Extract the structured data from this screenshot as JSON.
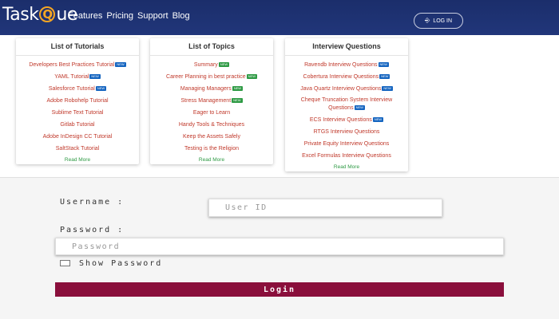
{
  "header": {
    "logo_left": "Task",
    "logo_q": "Q",
    "logo_right": "ue",
    "nav": [
      "Features",
      "Pricing",
      "Support",
      "Blog"
    ],
    "login_label": "LOG IN",
    "login_icon": "login-icon"
  },
  "panels": [
    {
      "title": "List of Tutorials",
      "items": [
        {
          "text": "Developers Best Practices Tutorial",
          "badge": "NEW"
        },
        {
          "text": "YAML Tutorial",
          "badge": "NEW"
        },
        {
          "text": "Salesforce Tutorial",
          "badge": "NEW"
        },
        {
          "text": "Adobe Robohelp Tutorial"
        },
        {
          "text": "Sublime Text Tutorial"
        },
        {
          "text": "Gitlab Tutorial"
        },
        {
          "text": "Adobe InDesign CC Tutorial"
        },
        {
          "text": "SaltStack Tutorial"
        }
      ],
      "read_more": "Read More"
    },
    {
      "title": "List of Topics",
      "items": [
        {
          "text": "Summary",
          "badge": "NEW"
        },
        {
          "text": "Career Planning in best practice",
          "badge": "NEW"
        },
        {
          "text": "Managing Managers",
          "badge": "NEW"
        },
        {
          "text": "Stress Management",
          "badge": "NEW"
        },
        {
          "text": "Eager to Learn"
        },
        {
          "text": "Handy Tools & Techniques"
        },
        {
          "text": "Keep the Assets Safely"
        },
        {
          "text": "Testing is the Religion"
        }
      ],
      "read_more": "Read More"
    },
    {
      "title": "Interview Questions",
      "items": [
        {
          "text": "Ravendb Interview Questions",
          "badge": "NEW"
        },
        {
          "text": "Cobertura Interview Questions",
          "badge": "NEW"
        },
        {
          "text": "Java Quartz Interview Questions",
          "badge": "NEW"
        },
        {
          "text": "Cheque Truncation System Interview Questions",
          "badge": "NEW"
        },
        {
          "text": "ECS Interview Questions",
          "badge": "NEW"
        },
        {
          "text": "RTGS Interview Questions"
        },
        {
          "text": "Private Equity Interview Questions"
        },
        {
          "text": "Excel Formulas Interview Questions"
        }
      ],
      "read_more": "Read More"
    }
  ],
  "form": {
    "username_label": "Username :",
    "username_placeholder": "User ID",
    "password_label": "Password :",
    "password_placeholder": "Password",
    "show_password_label": "Show Password",
    "submit_label": "Login"
  },
  "colors": {
    "header_bg": "#1b2e6b",
    "accent_logo": "#f5a623",
    "link_red": "#c0392b",
    "read_more_green": "#2e9a44",
    "badge_blue": "#1565c0",
    "badge_green": "#2e9a44",
    "submit_bg": "#8a0f3c"
  }
}
